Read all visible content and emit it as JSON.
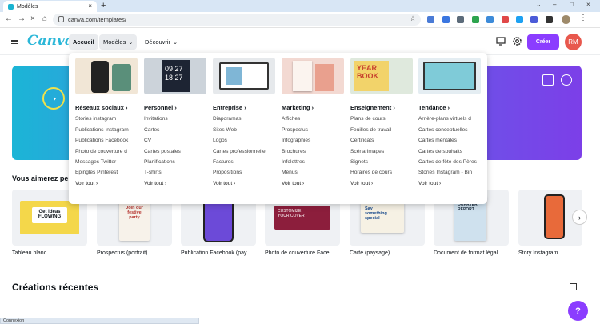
{
  "browser": {
    "tab_title": "Modèles",
    "url": "canva.com/templates/"
  },
  "header": {
    "logo": "Canva",
    "nav": [
      "Accueil",
      "Modèles",
      "Découvrir"
    ],
    "create_label": "Créer",
    "avatar_initials": "RM"
  },
  "menu": {
    "columns": [
      {
        "title": "Réseaux sociaux",
        "items": [
          "Stories instagram",
          "Publications Instagram",
          "Publications Facebook",
          "Photo de couverture d",
          "Messages Twitter",
          "Épingles Pinterest"
        ],
        "more": "Voir tout"
      },
      {
        "title": "Personnel",
        "items": [
          "Invitations",
          "Cartes",
          "CV",
          "Cartes postales",
          "Planifications",
          "T-shirts"
        ],
        "more": "Voir tout"
      },
      {
        "title": "Entreprise",
        "items": [
          "Diaporamas",
          "Sites Web",
          "Logos",
          "Cartes professionnelle",
          "Factures",
          "Propositions"
        ],
        "more": "Voir tout"
      },
      {
        "title": "Marketing",
        "items": [
          "Affiches",
          "Prospectus",
          "Infographies",
          "Brochures",
          "Infolettres",
          "Menus"
        ],
        "more": "Voir tout"
      },
      {
        "title": "Enseignement",
        "items": [
          "Plans de cours",
          "Feuilles de travail",
          "Certificats",
          "Scénarimages",
          "Signets",
          "Horaires de cours"
        ],
        "more": "Voir tout"
      },
      {
        "title": "Tendance",
        "items": [
          "Arrière-plans virtuels d",
          "Cartes conceptuelles",
          "Cartes mentales",
          "Cartes de souhaits",
          "Cartes de fête des Pères",
          "Stories Instagram - Bin"
        ],
        "more": "Voir tout"
      }
    ]
  },
  "suggestions": {
    "title": "Vous aimerez pe",
    "tiles": [
      {
        "label": "Tableau blanc",
        "thumb_text": "Get ideas\nFLOWING"
      },
      {
        "label": "Prospectus (portrait)",
        "thumb_text": "Join our\nfestive\nparty"
      },
      {
        "label": "Publication Facebook (pay…",
        "thumb_text": ""
      },
      {
        "label": "Photo de couverture Face…",
        "thumb_text": "CUSTOMIZE\nYOUR COVER"
      },
      {
        "label": "Carte (paysage)",
        "thumb_text": "Say\nsomething\nspecial"
      },
      {
        "label": "Document de format légal",
        "thumb_text": "QUARTER\nREPORT"
      },
      {
        "label": "Story Instagram",
        "thumb_text": ""
      }
    ]
  },
  "recent": {
    "title": "Créations récentes"
  },
  "status_bar": "Connexion",
  "colors": {
    "accent": "#8b3dff",
    "logo": "#2bb7d8",
    "avatar": "#e8584d"
  }
}
